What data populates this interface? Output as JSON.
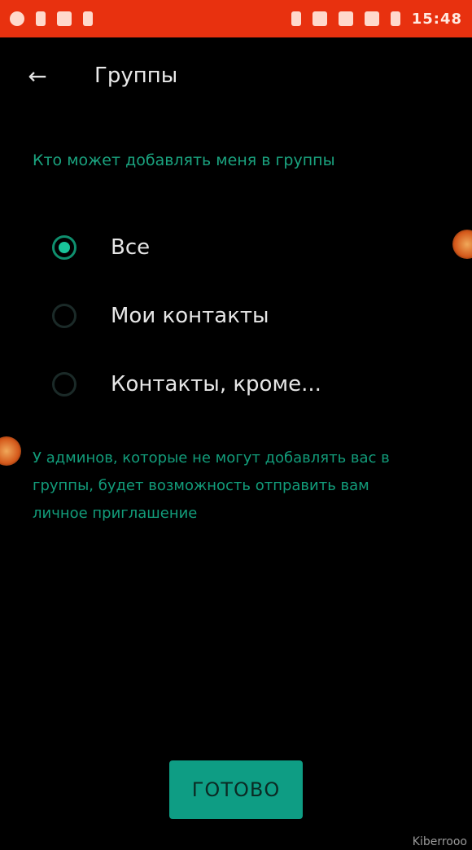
{
  "status_bar": {
    "time": "15:48"
  },
  "toolbar": {
    "back_icon": "arrow-left-icon",
    "title": "Группы"
  },
  "section": {
    "header": "Кто может добавлять меня в группы"
  },
  "options": [
    {
      "label": "Все",
      "selected": true
    },
    {
      "label": "Мои контакты",
      "selected": false
    },
    {
      "label": "Контакты, кроме...",
      "selected": false
    }
  ],
  "info": {
    "text": "У админов, которые не могут добавлять вас в группы, будет возможность отправить вам личное приглашение"
  },
  "done_button": {
    "label": "ГОТОВО"
  },
  "watermark": {
    "text": "Kiberrooo"
  },
  "colors": {
    "status_bar": "#e8310f",
    "accent": "#0e9d84",
    "background": "#000000"
  }
}
